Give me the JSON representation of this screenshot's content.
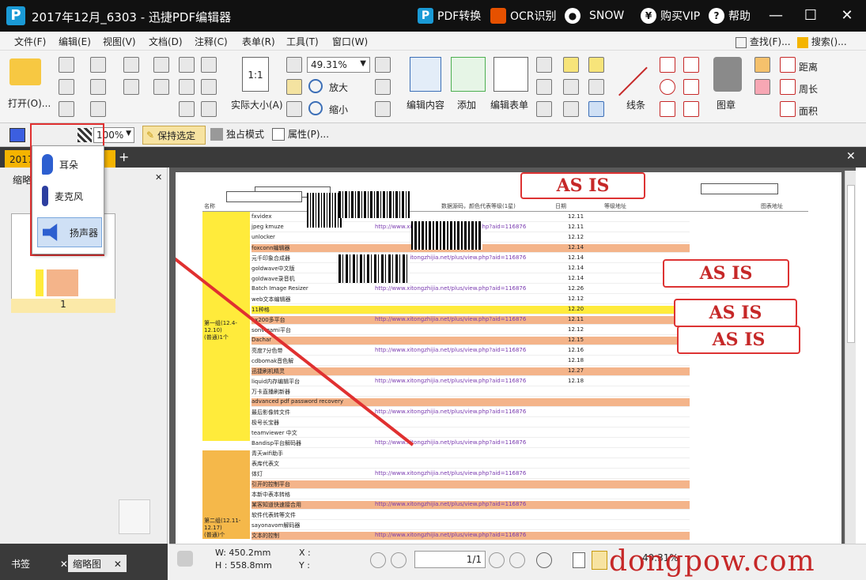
{
  "titlebar": {
    "logo": "P",
    "title": "2017年12月_6303 - 迅捷PDF编辑器",
    "pdf_convert": "PDF转换",
    "ocr": "OCR识别",
    "user": "SNOW",
    "vip": "购买VIP",
    "help": "帮助",
    "yen": "¥",
    "help_q": "?"
  },
  "menu": [
    "文件(F)",
    "编辑(E)",
    "视图(V)",
    "文档(D)",
    "注释(C)",
    "表单(R)",
    "工具(T)",
    "窗口(W)"
  ],
  "menu_right": {
    "find": "查找(F)...",
    "search": "搜索()..."
  },
  "toolbar": {
    "open": "打开(O)...",
    "zoom_value": "49.31%",
    "zoom_in": "放大",
    "zoom_out": "缩小",
    "actual_size": "实际大小(A)",
    "edit_content": "编辑内容",
    "add": "添加",
    "edit_form": "编辑表单",
    "line": "线条",
    "stamp": "图章",
    "distance": "距离",
    "perimeter": "周长",
    "area": "面积"
  },
  "toolbar2": {
    "opacity": "100%",
    "keep_selected": "保持选定",
    "exclusive": "独占模式",
    "properties": "属性(P)..."
  },
  "doc_tab": "2017年",
  "left_panel": {
    "header": "缩略图",
    "page_number": "1"
  },
  "dropdown": {
    "items": [
      "耳朵",
      "麦克风",
      "扬声器"
    ]
  },
  "sidebar_tabs": {
    "bookmarks": "书签",
    "thumbnails": "缩略图"
  },
  "stamps": [
    "AS IS",
    "AS IS",
    "AS IS",
    "AS IS"
  ],
  "document": {
    "header": [
      "名称",
      "",
      "数据源码，颜色代表等级(1星)",
      "日期",
      "等级地址",
      "图表地址"
    ],
    "rows": [
      "fxvidex",
      "jpeg kmuze",
      "unlocker",
      "foxconn编辑器",
      "元千印象合成器",
      "goldwave中文版",
      "goldwave录音机",
      "Batch Image Resizer",
      "web文本编辑器",
      "11种格",
      "ex200多平台",
      "sonvigami平台",
      "Dachar",
      "亮度7分色带",
      "cdbomak音色解",
      "迅捷刷机精灵",
      "liquid内存编辑平台",
      "万卡直播刷新器",
      "advanced pdf password recovery",
      "最后影像转文件",
      "极号长宝器",
      "teamviewer 中文",
      "Bandisp平台解码器",
      "青天wifi助手",
      "表库代表文",
      "体灯",
      "引开的控制平台",
      "本新中表本转格",
      "某客知道快速接合用",
      "软件代表转等文件",
      "sayonavom解码器",
      "文本的控制"
    ],
    "group1": "第一组(12.4-12.10)\n(普通)1个",
    "group2": "第二组(12.11-12.17)\n(普通)个",
    "sample_link": "http://www.xitongzhijia.net/plus/view.php?aid=116876",
    "dates": [
      "12.11",
      "12.11",
      "12.12",
      "12.14",
      "12.14",
      "12.14",
      "12.14",
      "12.26",
      "12.12",
      "12.20",
      "12.11",
      "12.12",
      "12.15",
      "12.16",
      "12.18",
      "12.27",
      "12.18"
    ]
  },
  "status": {
    "width": "W: 450.2mm",
    "height": "H : 558.8mm",
    "x": "X :",
    "y": "Y :",
    "page": "1/1",
    "zoom": "49.31%"
  },
  "watermark": "dongpow.com"
}
